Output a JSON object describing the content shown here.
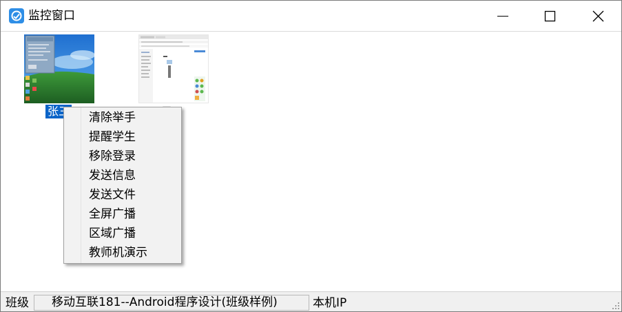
{
  "window": {
    "title": "监控窗口",
    "icon": "app-logo-icon",
    "controls": [
      "minimize-icon",
      "maximize-icon",
      "close-icon"
    ]
  },
  "students": [
    {
      "name": "张三",
      "selected": true
    },
    {
      "name": "元",
      "selected": false
    }
  ],
  "context_menu": {
    "items": [
      {
        "label": "清除举手"
      },
      {
        "label": "提醒学生"
      },
      {
        "label": "移除登录"
      },
      {
        "label": "发送信息"
      },
      {
        "label": "发送文件"
      },
      {
        "label": "全屏广播"
      },
      {
        "label": "区域广播"
      },
      {
        "label": "教师机演示"
      }
    ]
  },
  "status": {
    "class_label": "班级",
    "class_value": "移动互联181--Android程序设计(班级样例)",
    "ip_label": "本机IP"
  },
  "colors": {
    "accent": "#0A64C8",
    "app_icon": "#2E8EE6",
    "menu_bg": "#F2F2F2",
    "statusbar_bg": "#F0F0F0"
  }
}
